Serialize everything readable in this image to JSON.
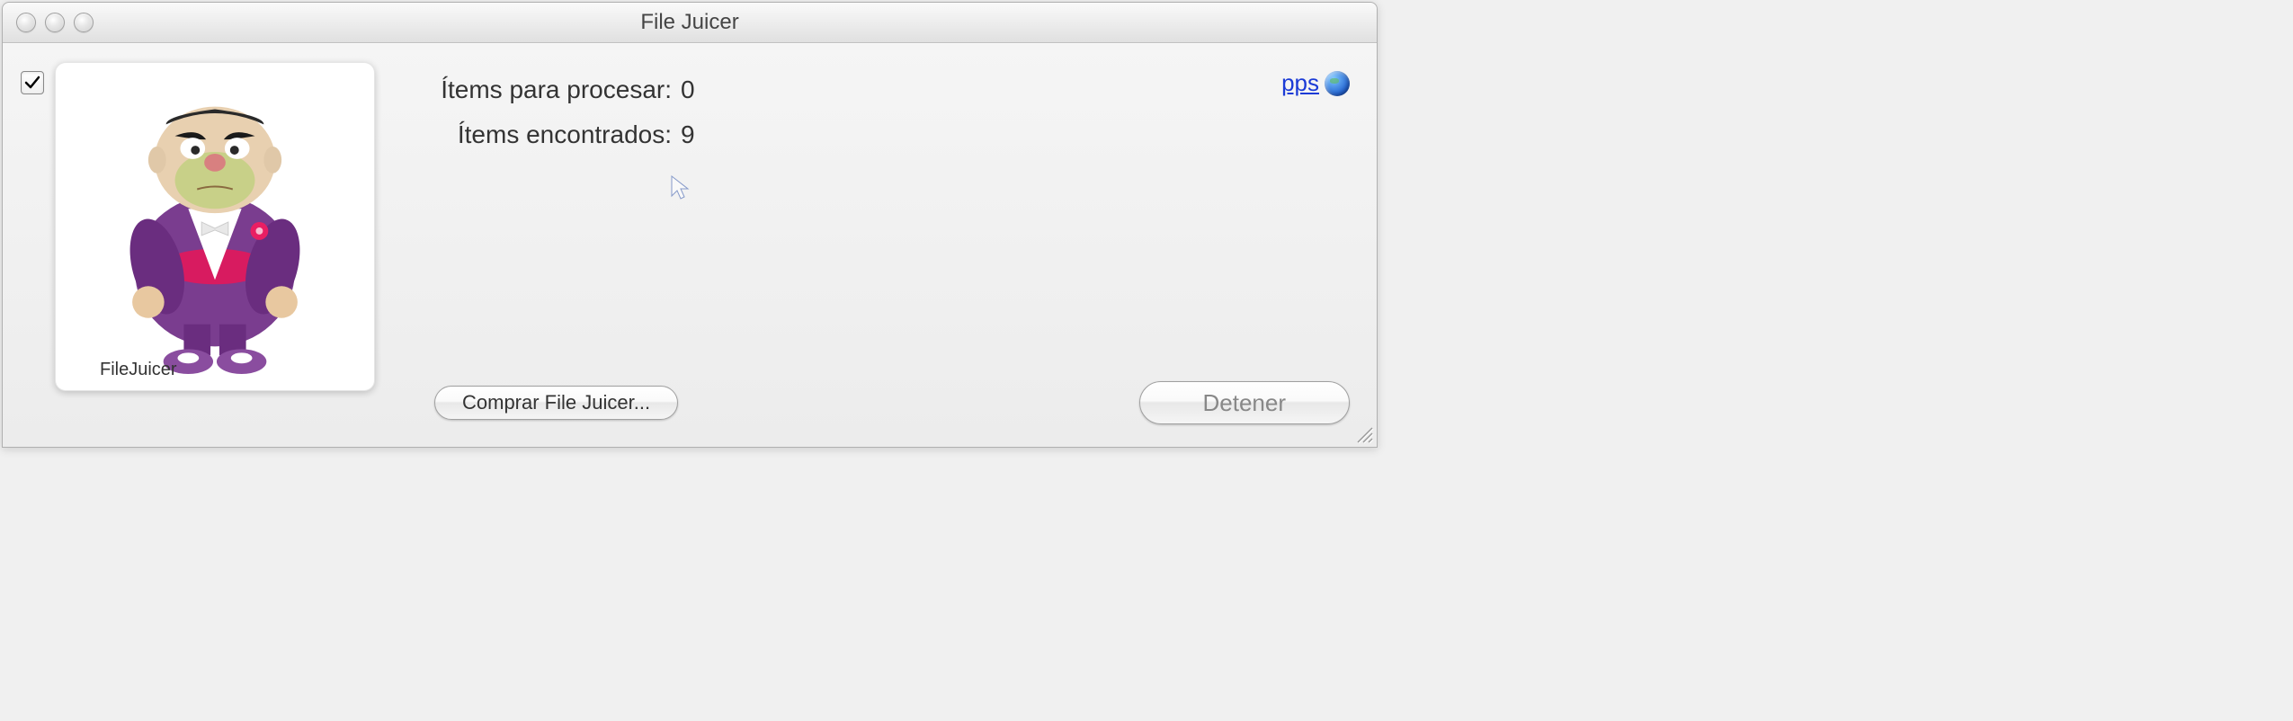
{
  "window": {
    "title": "File Juicer"
  },
  "checkbox": {
    "checked": true
  },
  "preview": {
    "caption": "FileJuicer"
  },
  "status": {
    "items_to_process_label": "Ítems para procesar:",
    "items_to_process_value": "0",
    "items_found_label": "Ítems encontrados:",
    "items_found_value": "9"
  },
  "link": {
    "text": "pps"
  },
  "buttons": {
    "buy": "Comprar File Juicer...",
    "stop": "Detener"
  }
}
